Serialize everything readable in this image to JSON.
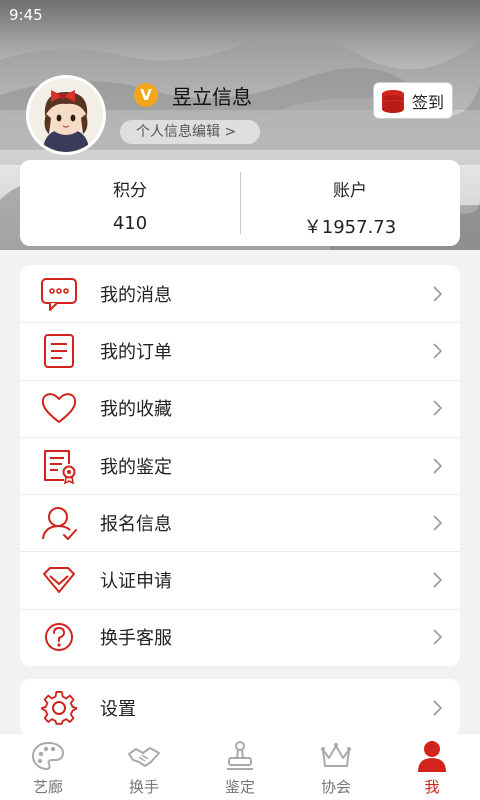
{
  "status_bar": {
    "time": "9:45"
  },
  "profile": {
    "badge": "V",
    "username": "昱立信息",
    "edit_link": "个人信息编辑 >",
    "signin_label": "签到"
  },
  "stats": [
    {
      "title": "积分",
      "value": "410"
    },
    {
      "title": "账户",
      "value": "￥1957.73"
    }
  ],
  "menu": [
    {
      "label": "我的消息",
      "icon": "message-icon"
    },
    {
      "label": "我的订单",
      "icon": "order-icon"
    },
    {
      "label": "我的收藏",
      "icon": "heart-icon"
    },
    {
      "label": "我的鉴定",
      "icon": "certificate-icon"
    },
    {
      "label": "报名信息",
      "icon": "user-check-icon"
    },
    {
      "label": "认证申请",
      "icon": "diamond-icon"
    },
    {
      "label": "换手客服",
      "icon": "help-icon"
    }
  ],
  "settings": {
    "label": "设置",
    "icon": "gear-icon"
  },
  "tabs": [
    {
      "label": "艺廊",
      "icon": "palette-icon"
    },
    {
      "label": "换手",
      "icon": "handshake-icon"
    },
    {
      "label": "鉴定",
      "icon": "stamp-icon"
    },
    {
      "label": "协会",
      "icon": "crown-icon"
    },
    {
      "label": "我",
      "icon": "person-icon",
      "active": true
    }
  ],
  "colors": {
    "accent": "#d0241d",
    "badge": "#f3a61c"
  }
}
